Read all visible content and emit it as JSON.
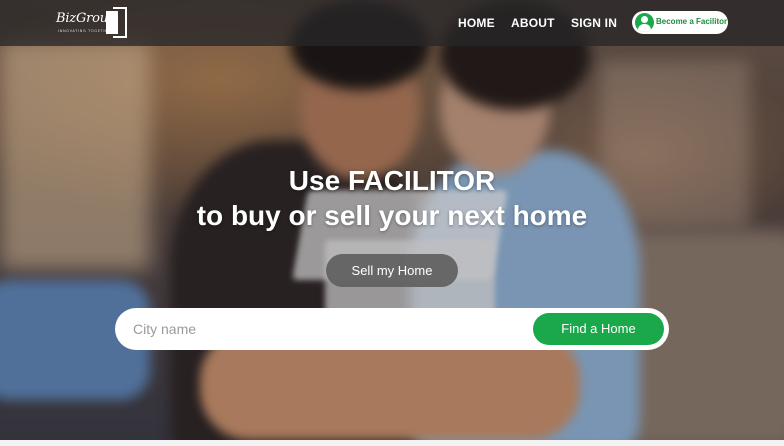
{
  "brand": {
    "name": "BizGroup",
    "tagline": "INNOVATING TOGETHER"
  },
  "nav": {
    "items": [
      {
        "label": "HOME"
      },
      {
        "label": "ABOUT"
      },
      {
        "label": "SIGN IN"
      }
    ],
    "cta_label": "Become a Facilitor",
    "cta_icon": "user-avatar-icon"
  },
  "hero": {
    "headline_line1": "Use FACILITOR",
    "headline_line2": "to buy or sell your next home",
    "sell_button_label": "Sell my Home"
  },
  "search": {
    "placeholder": "City name",
    "value": "",
    "button_label": "Find a Home"
  },
  "colors": {
    "accent_green": "#1aa84a",
    "navbar_bg": "#282628",
    "sell_button_bg": "#5f5f5f"
  }
}
